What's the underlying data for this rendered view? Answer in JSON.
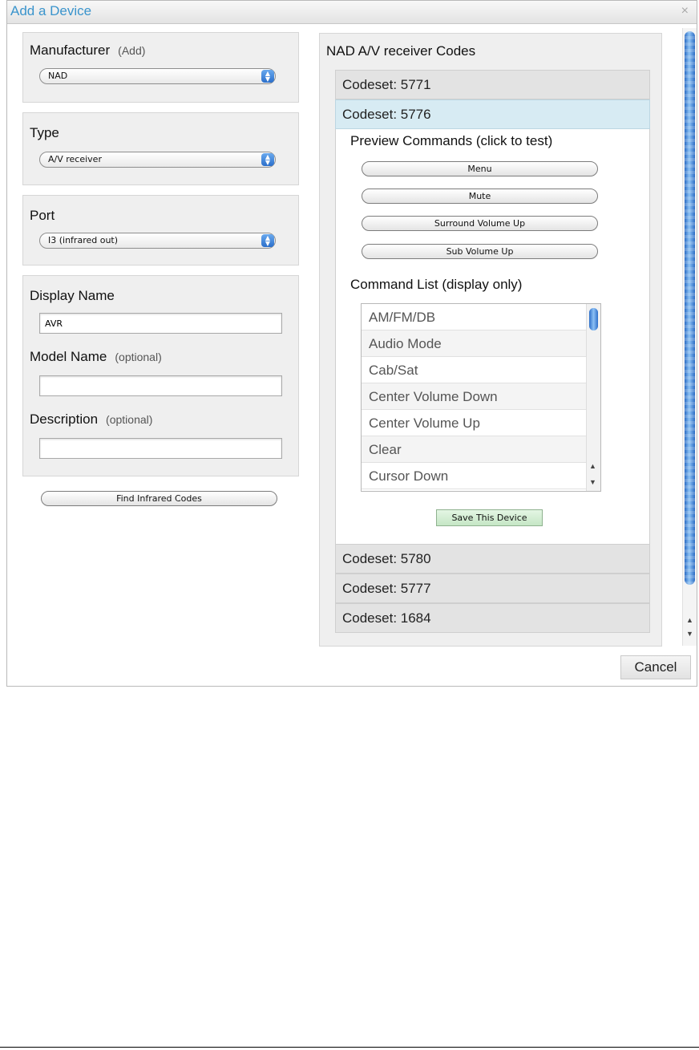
{
  "dialog": {
    "title": "Add a Device",
    "close_glyph": "×"
  },
  "manufacturer": {
    "label": "Manufacturer",
    "add_link": "(Add)",
    "selected": "NAD"
  },
  "type": {
    "label": "Type",
    "selected": "A/V receiver"
  },
  "port": {
    "label": "Port",
    "selected": "I3 (infrared out)"
  },
  "details": {
    "display_name_label": "Display Name",
    "display_name_value": "AVR",
    "model_name_label": "Model Name",
    "model_name_hint": "(optional)",
    "model_name_value": "",
    "description_label": "Description",
    "description_hint": "(optional)",
    "description_value": ""
  },
  "find_button": "Find Infrared Codes",
  "codes": {
    "heading": "NAD A/V receiver Codes",
    "codesets": [
      {
        "label": "Codeset: 5771",
        "active": false
      },
      {
        "label": "Codeset: 5776",
        "active": true
      },
      {
        "label": "Codeset: 5780",
        "active": false
      },
      {
        "label": "Codeset: 5777",
        "active": false
      },
      {
        "label": "Codeset: 1684",
        "active": false
      }
    ],
    "preview_heading": "Preview Commands (click to test)",
    "preview_commands": [
      "Menu",
      "Mute",
      "Surround Volume Up",
      "Sub Volume Up"
    ],
    "command_list_heading": "Command List (display only)",
    "command_list": [
      "AM/FM/DB",
      "Audio Mode",
      "Cab/Sat",
      "Center Volume Down",
      "Center Volume Up",
      "Clear",
      "Cursor Down"
    ],
    "save_button": "Save This Device"
  },
  "cancel_button": "Cancel",
  "scroll_arrows": {
    "up": "▲",
    "down": "▼"
  },
  "icons": {
    "close": "close-icon",
    "select_arrows": "updown-arrows-icon"
  },
  "colors": {
    "title": "#3a94cc",
    "active_codeset": "#d7ebf3",
    "save_button": "#c5e6c5"
  }
}
